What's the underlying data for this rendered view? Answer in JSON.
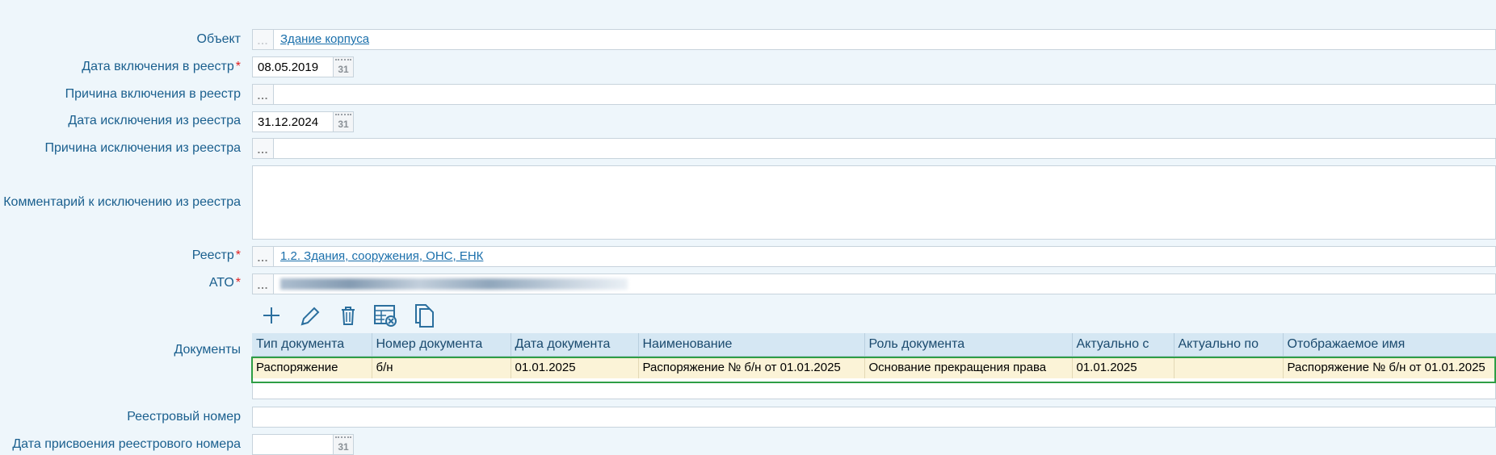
{
  "form": {
    "object": {
      "label": "Объект",
      "value": "Здание корпуса"
    },
    "include_date": {
      "label": "Дата включения в реестр",
      "required": "*",
      "value": "08.05.2019"
    },
    "include_reason": {
      "label": "Причина включения в реестр",
      "value": ""
    },
    "exclude_date": {
      "label": "Дата исключения из реестра",
      "value": "31.12.2024"
    },
    "exclude_reason": {
      "label": "Причина исключения из реестра",
      "value": ""
    },
    "exclude_comment": {
      "label": "Комментарий к исключению из реестра",
      "value": ""
    },
    "registry": {
      "label": "Реестр",
      "required": "*",
      "value": "1.2. Здания, сооружения, ОНС, ЕНК"
    },
    "ato": {
      "label": "АТО",
      "required": "*"
    },
    "documents": {
      "label": "Документы"
    },
    "registry_number": {
      "label": "Реестровый номер",
      "value": ""
    },
    "registry_number_date": {
      "label": "Дата присвоения реестрового номера",
      "value": ""
    }
  },
  "calendar_icon_text": "31",
  "ellipsis_text": "...",
  "toolbar": {
    "icons": [
      "plus-icon",
      "pencil-icon",
      "trash-icon",
      "table-remove-icon",
      "copy-icon"
    ]
  },
  "documents_table": {
    "columns": [
      "Тип документа",
      "Номер документа",
      "Дата документа",
      "Наименование",
      "Роль документа",
      "Актуально с",
      "Актуально по",
      "Отображаемое имя"
    ],
    "rows": [
      [
        "Распоряжение",
        "б/н",
        "01.01.2025",
        "Распоряжение № б/н от 01.01.2025",
        "Основание прекращения права",
        "01.01.2025",
        "",
        "Распоряжение № б/н от 01.01.2025"
      ]
    ]
  },
  "colors": {
    "background": "#eef6fb",
    "label": "#1a5f8e",
    "link": "#1a6fab",
    "required": "#e02020",
    "selected_row": "#fbf3d7",
    "selected_outline": "#2e9e45",
    "header_bg": "#d5e7f3"
  }
}
